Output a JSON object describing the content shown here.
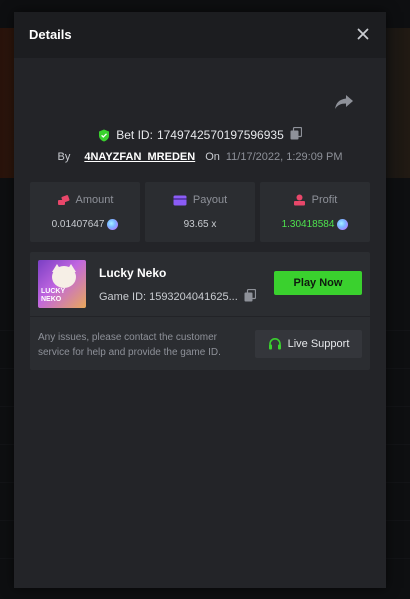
{
  "modal": {
    "title": "Details"
  },
  "bet": {
    "id_label": "Bet ID:",
    "id_value": "1749742570197596935",
    "by_label": "By",
    "username": "4NAYZFAN_MREDEN",
    "on_label": "On",
    "datetime": "11/17/2022, 1:29:09 PM"
  },
  "stats": [
    {
      "label": "Amount",
      "value": "0.01407647",
      "icon": "coins-icon",
      "currency_icon": "sol-coin-icon"
    },
    {
      "label": "Payout",
      "value": "93.65 x",
      "icon": "wallet-icon"
    },
    {
      "label": "Profit",
      "value": "1.30418584",
      "icon": "profit-icon",
      "currency_icon": "sol-coin-icon",
      "value_color": "#4ee24e"
    }
  ],
  "game": {
    "name": "Lucky Neko",
    "id_label": "Game ID:",
    "id_value": "1593204041625...",
    "thumb_text_line1": "LUCKY",
    "thumb_text_line2": "NEKO",
    "play_label": "Play Now",
    "help_text": "Any issues, please contact the customer service for help and provide the game ID.",
    "support_label": "Live Support"
  },
  "colors": {
    "accent_green": "#3ad12e",
    "profit_green": "#4ee24e",
    "amount_icon": "#e8476a",
    "payout_icon": "#8b5cf6",
    "profit_icon": "#e8476a"
  }
}
